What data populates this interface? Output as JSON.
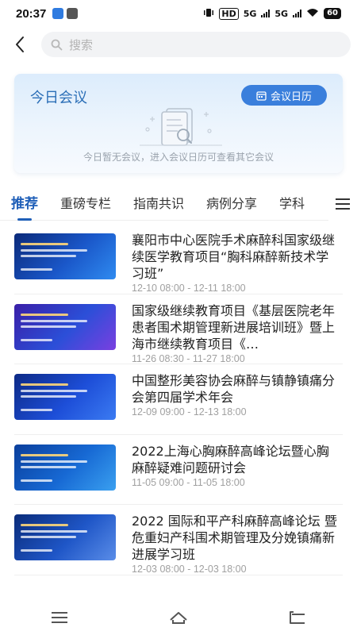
{
  "status_bar": {
    "time": "20:37",
    "network_label": "HD",
    "signal1": "5G",
    "signal2": "5G",
    "battery": "60"
  },
  "search": {
    "placeholder": "搜索"
  },
  "meeting_card": {
    "title": "今日会议",
    "calendar_button": "会议日历",
    "empty_text": "今日暂无会议，进入会议日历可查看其它会议"
  },
  "tabs": [
    {
      "label": "推荐",
      "active": true
    },
    {
      "label": "重磅专栏",
      "active": false
    },
    {
      "label": "指南共识",
      "active": false
    },
    {
      "label": "病例分享",
      "active": false
    },
    {
      "label": "学科",
      "active": false
    }
  ],
  "items": [
    {
      "title": "襄阳市中心医院手术麻醉科国家级继续医学教育项目“胸科麻醉新技术学习班”",
      "date": "12-10 08:00 - 12-11 18:00",
      "thumb_colors": [
        "#0b2a7a",
        "#1a57c9",
        "#2f8bf0"
      ]
    },
    {
      "title": "国家级继续教育项目《基层医院老年患者围术期管理新进展培训班》暨上海市继续教育项目《…",
      "date": "11-26 08:30 - 11-27 18:00",
      "thumb_colors": [
        "#3a1fa8",
        "#2b4fd8",
        "#7a3fe0"
      ]
    },
    {
      "title": "中国整形美容协会麻醉与镇静镇痛分会第四届学术年会",
      "date": "12-09 09:00 - 12-13 18:00",
      "thumb_colors": [
        "#0d2a86",
        "#1d4ed8",
        "#3b7bf2"
      ]
    },
    {
      "title": "2022上海心胸麻醉高峰论坛暨心胸麻醉疑难问题研讨会",
      "date": "11-05 09:00 - 11-05 18:00",
      "thumb_colors": [
        "#0a3f9c",
        "#1769d4",
        "#3aa0f0"
      ]
    },
    {
      "title": "2022 国际和平产科麻醉高峰论坛 暨危重妇产科围术期管理及分娩镇痛新进展学习班",
      "date": "12-03 08:00 - 12-03 18:00",
      "thumb_colors": [
        "#0a2c7a",
        "#1f56c7",
        "#5a8de8"
      ]
    }
  ],
  "colors": {
    "accent": "#1f5fb8",
    "card_title": "#2b6fb7",
    "calendar_button": "#3a7fdc",
    "date_text": "#a0a0a0"
  }
}
